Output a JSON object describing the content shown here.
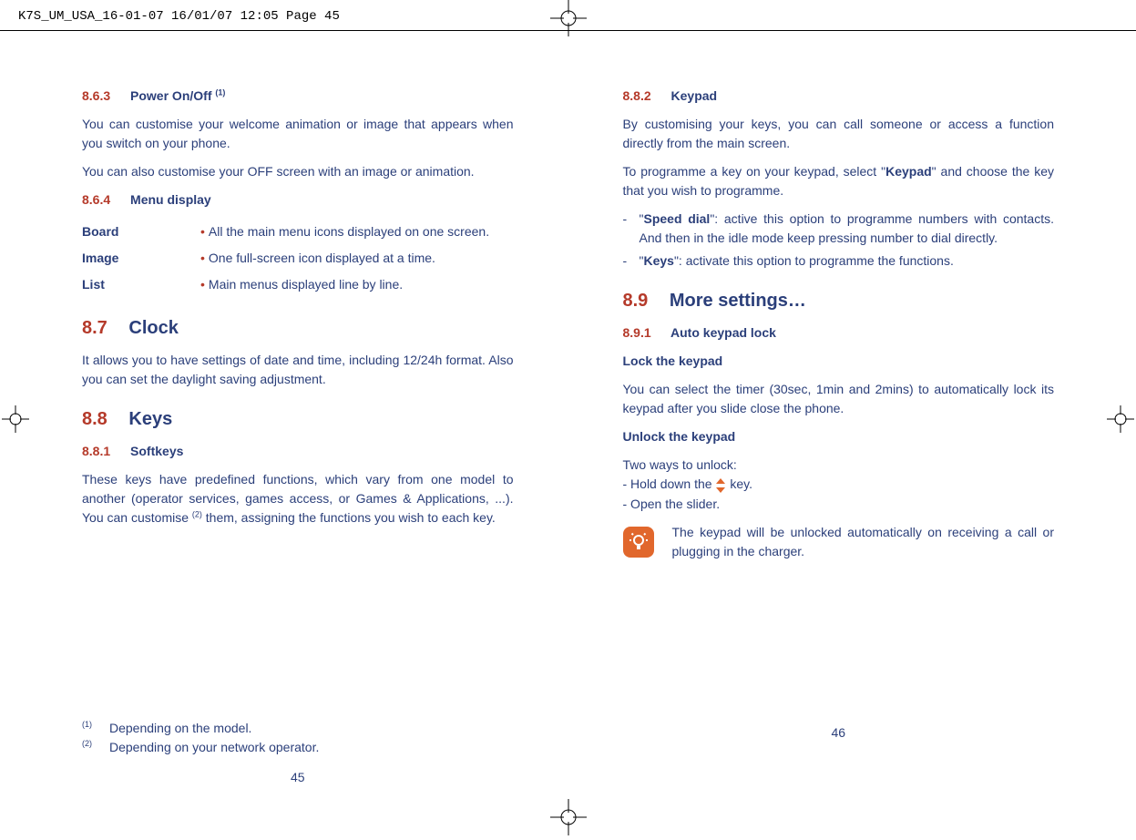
{
  "print_header": "K7S_UM_USA_16-01-07  16/01/07  12:05  Page 45",
  "left": {
    "s863_num": "8.6.3",
    "s863_title": "Power On/Off ",
    "s863_sup": "(1)",
    "s863_p1": "You can customise your welcome animation or image that appears when you switch on your phone.",
    "s863_p2": "You can also customise your OFF screen with an image or animation.",
    "s864_num": "8.6.4",
    "s864_title": "Menu display",
    "menu": {
      "board_label": "Board",
      "board_desc": "All the main menu icons displayed on one screen.",
      "image_label": "Image",
      "image_desc": "One full-screen icon displayed at a time.",
      "list_label": "List",
      "list_desc": "Main menus displayed line by line."
    },
    "s87_num": "8.7",
    "s87_title": "Clock",
    "s87_p": "It allows you to have settings of date and time, including 12/24h format. Also you can set the daylight saving adjustment.",
    "s88_num": "8.8",
    "s88_title": "Keys",
    "s881_num": "8.8.1",
    "s881_title": "Softkeys",
    "s881_p_a": "These keys have predefined functions, which vary from one model to another (operator services, games access, or Games & Applications, ...). You can customise ",
    "s881_sup": "(2)",
    "s881_p_b": " them, assigning the functions you wish to each key.",
    "fn1_sup": "(1)",
    "fn1_txt": "Depending on the model.",
    "fn2_sup": "(2)",
    "fn2_txt": "Depending on your network operator.",
    "pagenum": "45"
  },
  "right": {
    "s882_num": "8.8.2",
    "s882_title": "Keypad",
    "s882_p1": "By customising your keys, you can call someone or access a function directly from the main screen.",
    "s882_p2a": "To programme a key on your keypad, select \"",
    "s882_p2_bold": "Keypad",
    "s882_p2b": "\" and choose the key that you wish to programme.",
    "li1_bold": "Speed dial",
    "li1_rest": "\": active this option to programme numbers with contacts. And then in the idle mode keep pressing number to dial directly.",
    "li2_bold": "Keys",
    "li2_rest": "\": activate this option to programme the functions.",
    "s89_num": "8.9",
    "s89_title": "More settings…",
    "s891_num": "8.9.1",
    "s891_title": "Auto keypad lock",
    "lock_h": "Lock the keypad",
    "lock_p": "You can select the timer (30sec, 1min and 2mins) to automatically lock its keypad after you slide close the phone.",
    "unlock_h": "Unlock the keypad",
    "unlock_p1": "Two ways to unlock:",
    "unlock_p2a": "- Hold down the ",
    "unlock_p2b": " key.",
    "unlock_p3": "- Open the slider.",
    "note": "The keypad will be unlocked automatically on receiving a call or plugging in the charger.",
    "pagenum": "46"
  }
}
